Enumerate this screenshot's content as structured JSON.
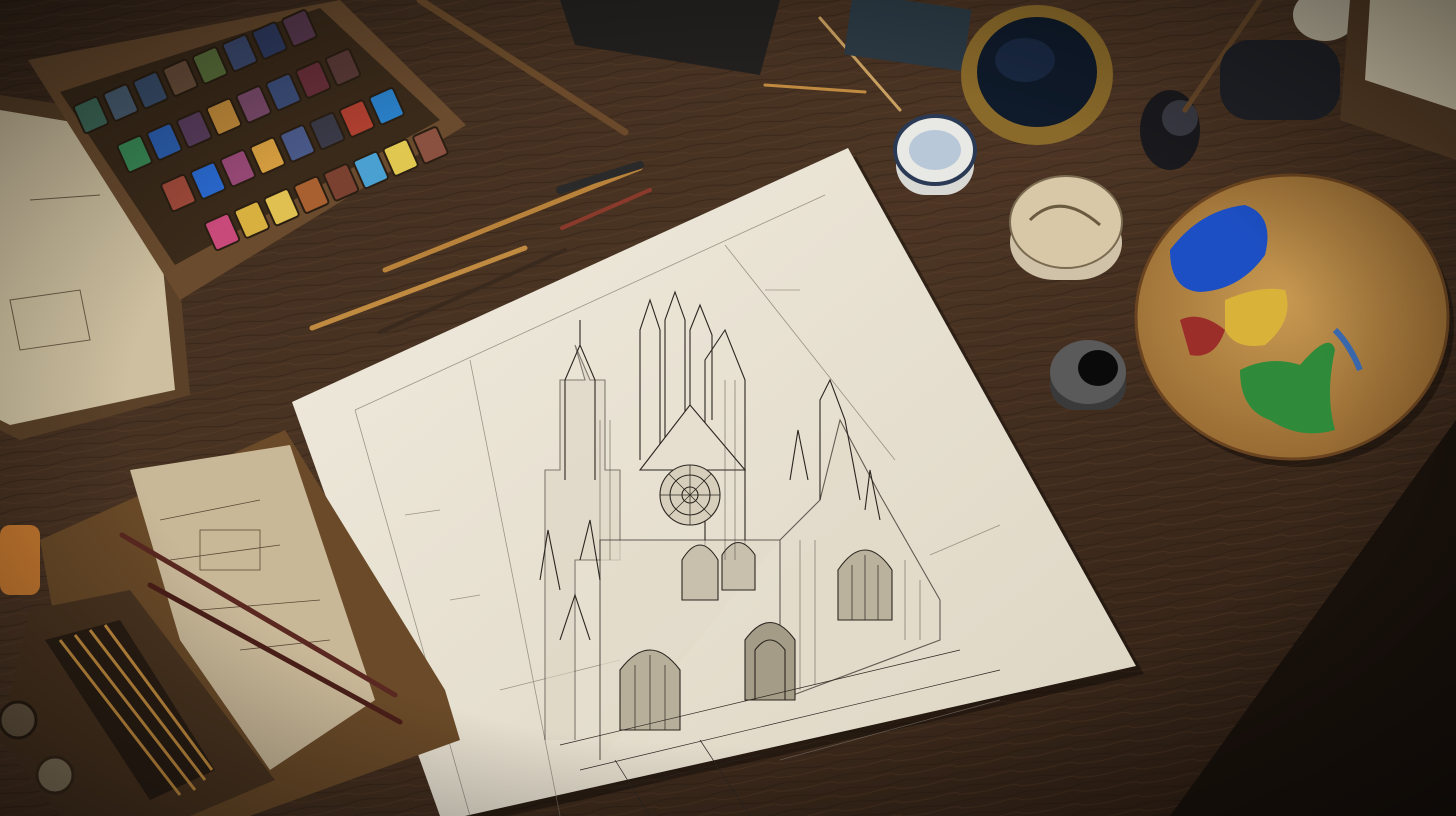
{
  "scene": {
    "subject": "gothic-cathedral-sketch-on-artist-desk",
    "palette": {
      "desk_dark": "#2a1d14",
      "desk_mid": "#4a3322",
      "desk_light": "#6b4a30",
      "paper": "#ece6d8",
      "paper_shadow": "#c9c0ad",
      "ink": "#2b2620",
      "palette_wood": "#b8843f",
      "paint_blue": "#1d4fc4",
      "paint_yellow": "#d9b23a",
      "paint_green": "#2f8a3a",
      "paint_red": "#9c2e2a"
    },
    "icons": [
      "watercolor-box",
      "paint-palette",
      "paint-brush",
      "ink-pot",
      "sketchbook",
      "pencil-tray"
    ],
    "watercolor_pans": [
      "#3f6a5a",
      "#4a5f73",
      "#3a4f6d",
      "#6a4e3a",
      "#5a6f3a",
      "#3c4a70",
      "#2f3c62",
      "#5a3a50",
      "#3a8a57",
      "#2c5fb0",
      "#5a3e5e",
      "#c08a3a",
      "#7a4a6a",
      "#3c4e7a",
      "#6a2f3a",
      "#5a3a38",
      "#a04a3a",
      "#2a6ad0",
      "#9a4a78",
      "#d9a040",
      "#4a5a8a",
      "#3a3a48",
      "#b04030",
      "#2a80c8",
      "#c84a7a",
      "#d8b040",
      "#e0c050",
      "#a86030",
      "#7a4030",
      "#4aa0d0",
      "#e0c850",
      "#8a5040"
    ]
  }
}
